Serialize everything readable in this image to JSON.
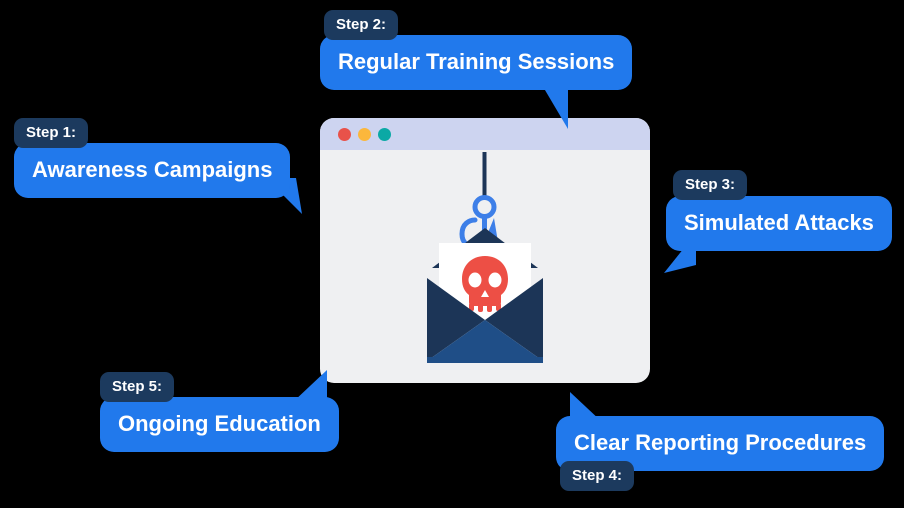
{
  "illustration": {
    "name": "phishing-email-browser-window",
    "window_dots": [
      {
        "name": "close-dot",
        "color": "#E8524A"
      },
      {
        "name": "minimize-dot",
        "color": "#FBB73C"
      },
      {
        "name": "maximize-dot",
        "color": "#0BA9A5"
      }
    ],
    "titlebar_color": "#CDD4F0",
    "window_body_color": "#EFF0F2",
    "hook_color": "#3D7FE8",
    "hook_line_color": "#1C3557",
    "envelope_back_color": "#1C3557",
    "envelope_front_color": "#1F4E87",
    "envelope_side_color": "#1C4272",
    "letter_color": "#FFFFFF",
    "skull_color": "#ED4F45"
  },
  "theme": {
    "background": "#000000",
    "bubble_color": "#2179EC",
    "badge_color": "#1C3A5E",
    "text_color": "#FFFFFF"
  },
  "steps": [
    {
      "badge": "Step 1:",
      "label": "Awareness Campaigns",
      "tail": "right"
    },
    {
      "badge": "Step 2:",
      "label": "Regular Training Sessions",
      "tail": "down"
    },
    {
      "badge": "Step 3:",
      "label": "Simulated Attacks",
      "tail": "left"
    },
    {
      "badge": "Step 4:",
      "label": "Clear Reporting Procedures",
      "tail": "up-left"
    },
    {
      "badge": "Step 5:",
      "label": "Ongoing Education",
      "tail": "up-right"
    }
  ]
}
